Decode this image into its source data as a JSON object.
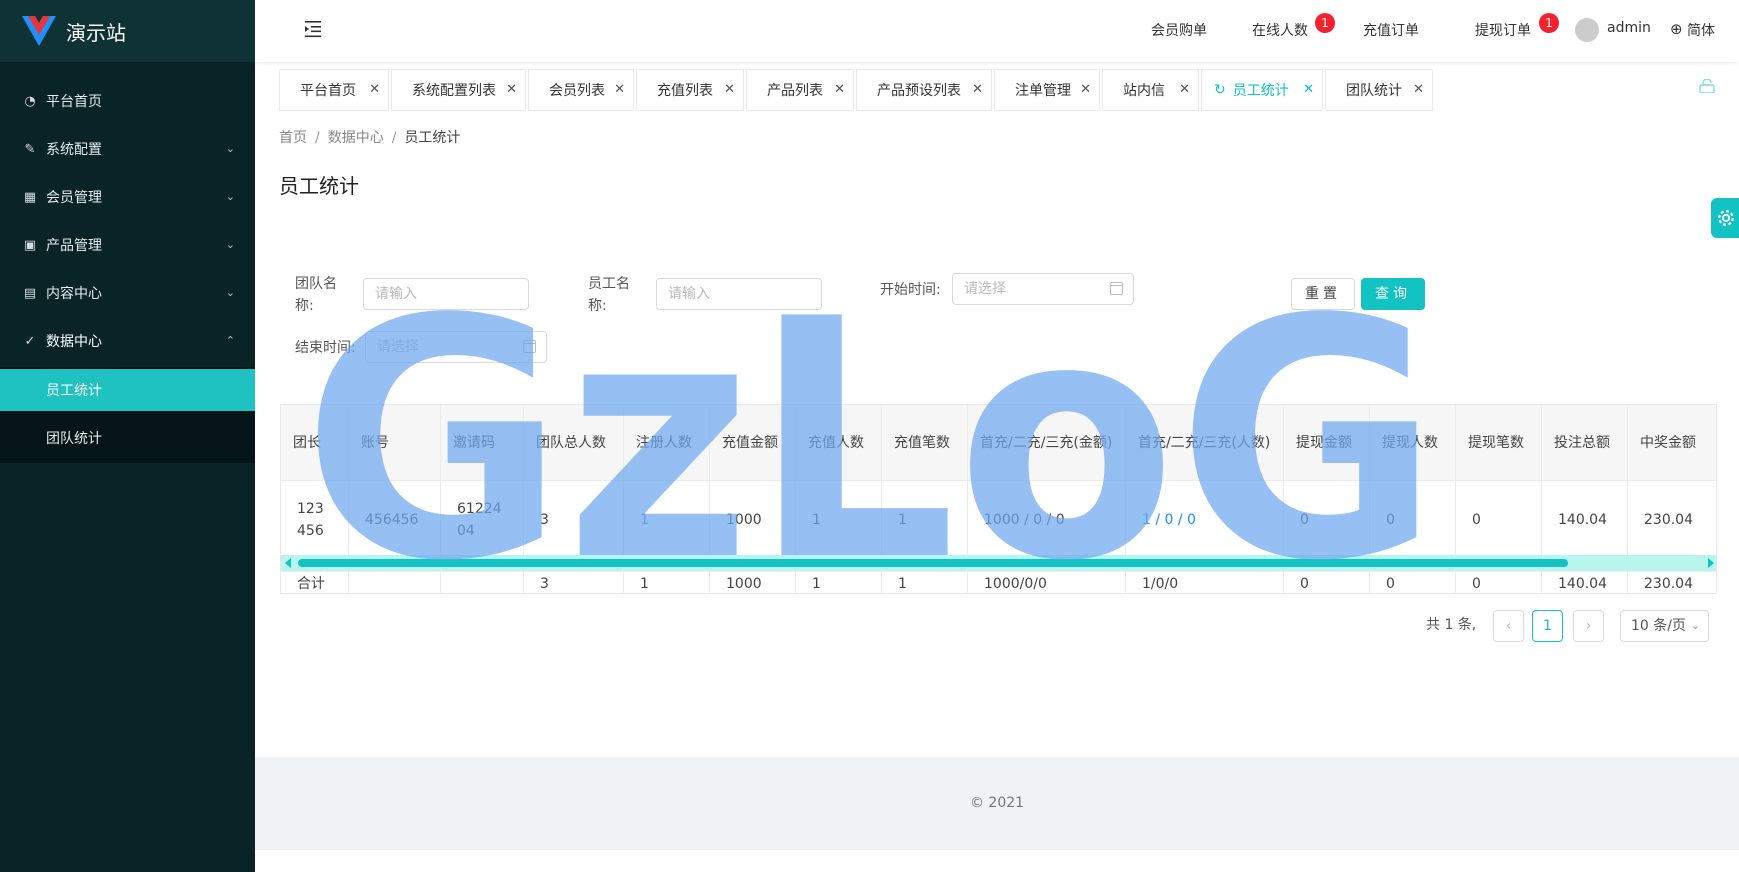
{
  "app": {
    "title": "演示站"
  },
  "sidebar": {
    "items": [
      {
        "label": "平台首页",
        "icon": "dashboard-icon"
      },
      {
        "label": "系统配置",
        "icon": "edit-icon"
      },
      {
        "label": "会员管理",
        "icon": "table-icon"
      },
      {
        "label": "产品管理",
        "icon": "appstore-icon"
      },
      {
        "label": "内容中心",
        "icon": "file-icon"
      },
      {
        "label": "数据中心",
        "icon": "check-circle-icon"
      }
    ],
    "subitems": [
      "员工统计",
      "团队统计"
    ],
    "active_subitem": "员工统计"
  },
  "header": {
    "links": [
      "会员购单",
      "在线人数",
      "充值订单",
      "提现订单"
    ],
    "badges": {
      "online": "1",
      "withdraw": "1"
    },
    "user": "admin",
    "lang": "简体"
  },
  "tabs": [
    "平台首页",
    "系统配置列表",
    "会员列表",
    "充值列表",
    "产品列表",
    "产品预设列表",
    "注单管理",
    "站内信",
    "员工统计",
    "团队统计"
  ],
  "active_tab": "员工统计",
  "breadcrumb": [
    "首页",
    "数据中心",
    "员工统计"
  ],
  "page_title": "员工统计",
  "filters": {
    "team_label": "团队名称:",
    "team_placeholder": "请输入",
    "staff_label": "员工名称:",
    "staff_placeholder": "请输入",
    "start_label": "开始时间:",
    "start_placeholder": "请选择",
    "end_label": "结束时间:",
    "end_placeholder": "请选择",
    "reset": "重置",
    "search": "查询"
  },
  "table": {
    "columns": [
      "团长",
      "账号",
      "邀请码",
      "团队总人数",
      "注册人数",
      "充值金额",
      "充值人数",
      "充值笔数",
      "首充/二充/三充(金额)",
      "首充/二充/三充(人数)",
      "提现金额",
      "提现人数",
      "提现笔数",
      "投注总额",
      "中奖金额"
    ],
    "rows": [
      [
        "123456",
        "456456",
        "6122404",
        "3",
        "1",
        "1000",
        "1",
        "1",
        "1000 / 0 / 0",
        "1 / 0 / 0",
        "0",
        "0",
        "0",
        "140.04",
        "230.04"
      ]
    ],
    "total_row": [
      "合计",
      "",
      "",
      "3",
      "1",
      "1000",
      "1",
      "1",
      "1000/0/0",
      "1/0/0",
      "0",
      "0",
      "0",
      "140.04",
      "230.04"
    ]
  },
  "pagination": {
    "total": "共 1 条,",
    "current": "1",
    "page_size": "10 条/页"
  },
  "footer": {
    "copyright": "2021"
  },
  "watermark": "GzLoG",
  "colors": {
    "accent": "#13c2c2",
    "sidebar_bg": "#0a2327",
    "link": "#1890ff",
    "badge": "#f5222d",
    "watermark": "#6ea8f0"
  }
}
